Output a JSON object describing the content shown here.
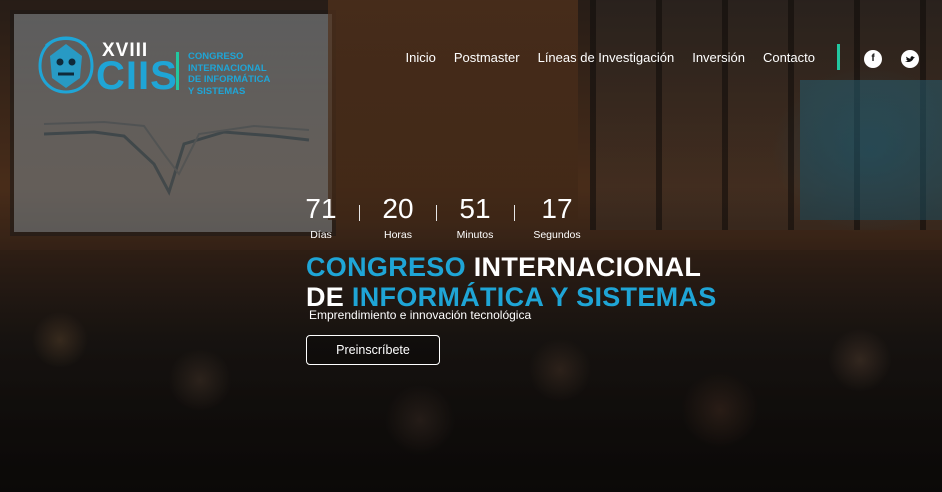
{
  "header": {
    "logo": {
      "edition": "XVIII",
      "acronym": "CIIS",
      "subtitle_lines": [
        "CONGRESO",
        "INTERNACIONAL",
        "DE INFORMÁTICA",
        "Y SISTEMAS"
      ]
    },
    "nav": [
      {
        "label": "Inicio"
      },
      {
        "label": "Postmaster"
      },
      {
        "label": "Líneas de Investigación"
      },
      {
        "label": "Inversión"
      },
      {
        "label": "Contacto"
      }
    ],
    "social": [
      {
        "icon": "facebook-icon",
        "glyph": "f"
      },
      {
        "icon": "twitter-icon",
        "glyph": "🐦"
      }
    ]
  },
  "countdown": [
    {
      "value": "71",
      "label": "Días"
    },
    {
      "value": "20",
      "label": "Horas"
    },
    {
      "value": "51",
      "label": "Minutos"
    },
    {
      "value": "17",
      "label": "Segundos"
    }
  ],
  "hero": {
    "title_line1_accent": "CONGRESO",
    "title_line1_rest": " INTERNACIONAL",
    "title_line2_start": "DE ",
    "title_line2_accent": "INFORMÁTICA Y SISTEMAS",
    "tagline": "Emprendimiento e innovación tecnológica",
    "cta_label": "Preinscríbete"
  },
  "colors": {
    "accent_blue": "#1fa5d6",
    "accent_green": "#22c7a0",
    "text": "#ffffff"
  }
}
